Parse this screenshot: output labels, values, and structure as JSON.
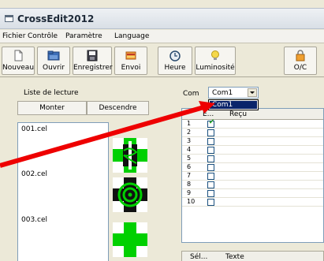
{
  "window": {
    "title": "CrossEdit2012"
  },
  "menu": {
    "items": [
      "Fichier",
      "Contrôle",
      "Paramètre",
      "Language"
    ]
  },
  "toolbar": {
    "buttons": [
      {
        "label": "Nouveau",
        "icon": "new-document-icon"
      },
      {
        "label": "Ouvrir",
        "icon": "open-folder-icon"
      },
      {
        "label": "Enregistrer",
        "icon": "save-floppy-icon"
      },
      {
        "label": "Envoi",
        "icon": "send-icon"
      },
      {
        "label": "Heure",
        "icon": "clock-icon"
      },
      {
        "label": "Luminosité",
        "icon": "lightbulb-icon"
      },
      {
        "label": "O/C",
        "icon": "lock-icon"
      }
    ]
  },
  "playlist": {
    "label": "Liste de lecture",
    "up_button": "Monter",
    "down_button": "Descendre",
    "files": [
      "001.cel",
      "002.cel",
      "003.cel"
    ]
  },
  "com": {
    "label": "Com",
    "selected": "Com1",
    "options": [
      "Com1"
    ]
  },
  "grid": {
    "columns": [
      "E...",
      "Reçu"
    ],
    "rows": [
      {
        "n": "1",
        "checked": true
      },
      {
        "n": "2",
        "checked": false
      },
      {
        "n": "3",
        "checked": false
      },
      {
        "n": "4",
        "checked": false
      },
      {
        "n": "5",
        "checked": false
      },
      {
        "n": "6",
        "checked": false
      },
      {
        "n": "7",
        "checked": false
      },
      {
        "n": "8",
        "checked": false
      },
      {
        "n": "9",
        "checked": false
      },
      {
        "n": "10",
        "checked": false
      }
    ]
  },
  "bottom_grid": {
    "columns": [
      "Sél...",
      "Texte"
    ]
  },
  "colors": {
    "annotation_arrow": "#ee0000",
    "pharmacy_green": "#00d000",
    "selection": "#0a246a"
  }
}
